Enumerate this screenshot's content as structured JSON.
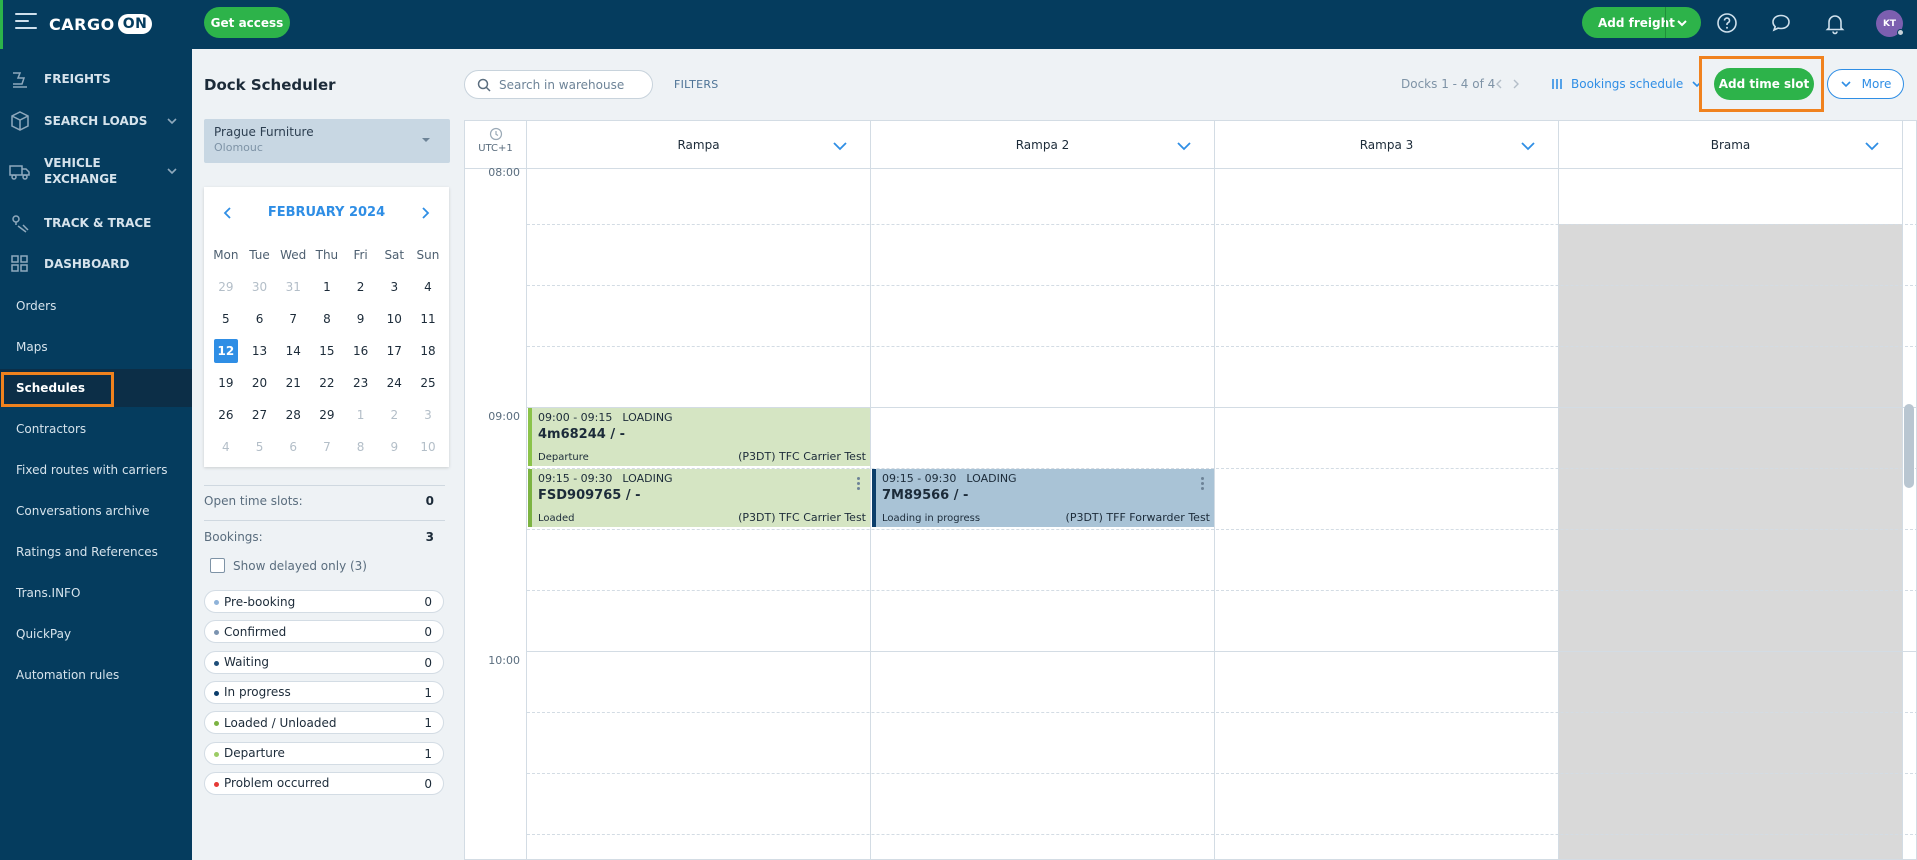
{
  "topbar": {
    "logo_text": "CARGO",
    "logo_on": "ON",
    "get_access": "Get access",
    "add_freight": "Add freight",
    "avatar_initials": "KT"
  },
  "sidebar": {
    "main_items": [
      {
        "label": "FREIGHTS",
        "icon": "freight-icon"
      },
      {
        "label": "SEARCH LOADS",
        "icon": "box-icon"
      },
      {
        "label": "VEHICLE EXCHANGE",
        "icon": "truck-icon"
      },
      {
        "label": "TRACK & TRACE",
        "icon": "track-icon"
      },
      {
        "label": "DASHBOARD",
        "icon": "dashboard-icon"
      }
    ],
    "sub_items": [
      "Orders",
      "Maps",
      "Schedules",
      "Contractors",
      "Fixed routes with carriers",
      "Conversations archive",
      "Ratings and References",
      "Trans.INFO",
      "QuickPay",
      "Automation rules"
    ],
    "active": "Schedules"
  },
  "panel": {
    "title": "Dock Scheduler",
    "warehouse_name": "Prague Furniture",
    "warehouse_city": "Olomouc"
  },
  "calendar": {
    "month": "FEBRUARY 2024",
    "dow": [
      "Mon",
      "Tue",
      "Wed",
      "Thu",
      "Fri",
      "Sat",
      "Sun"
    ],
    "weeks": [
      [
        "29",
        "30",
        "31",
        "1",
        "2",
        "3",
        "4"
      ],
      [
        "5",
        "6",
        "7",
        "8",
        "9",
        "10",
        "11"
      ],
      [
        "12",
        "13",
        "14",
        "15",
        "16",
        "17",
        "18"
      ],
      [
        "19",
        "20",
        "21",
        "22",
        "23",
        "24",
        "25"
      ],
      [
        "26",
        "27",
        "28",
        "29",
        "1",
        "2",
        "3"
      ],
      [
        "4",
        "5",
        "6",
        "7",
        "8",
        "9",
        "10"
      ]
    ],
    "selected": "12"
  },
  "summary": {
    "open_slots_label": "Open time slots:",
    "open_slots_value": "0",
    "bookings_label": "Bookings:",
    "bookings_value": "3",
    "delayed_label": "Show delayed only (3)"
  },
  "statuses": [
    {
      "label": "Pre-booking",
      "count": "0",
      "color": "#8fb3d9"
    },
    {
      "label": "Confirmed",
      "count": "0",
      "color": "#7b93b0"
    },
    {
      "label": "Waiting",
      "count": "0",
      "color": "#1f4e79"
    },
    {
      "label": "In progress",
      "count": "1",
      "color": "#0b3d6b"
    },
    {
      "label": "Loaded / Unloaded",
      "count": "1",
      "color": "#7cb342"
    },
    {
      "label": "Departure",
      "count": "1",
      "color": "#9ccc65"
    },
    {
      "label": "Problem occurred",
      "count": "0",
      "color": "#e53935"
    }
  ],
  "toolbar": {
    "search_placeholder": "Search in warehouse",
    "filters": "FILTERS",
    "docks_count": "Docks 1 - 4 of 4",
    "bookings_schedule": "Bookings schedule",
    "add_time_slot": "Add time slot",
    "more": "More"
  },
  "schedule": {
    "timezone": "UTC+1",
    "docks": [
      "Rampa",
      "Rampa 2",
      "Rampa 3",
      "Brama"
    ],
    "times": [
      "08:00",
      "09:00",
      "10:00"
    ],
    "bookings": [
      {
        "time": "09:00 - 09:15",
        "type": "LOADING",
        "id": "4m68244 / -",
        "status": "Departure",
        "carrier": "(P3DT) TFC Carrier Test",
        "color": "#d5e5c3",
        "border": "#8bc34a"
      },
      {
        "time": "09:15 - 09:30",
        "type": "LOADING",
        "id": "FSD909765 / -",
        "status": "Loaded",
        "carrier": "(P3DT) TFC Carrier Test",
        "color": "#d5e5c3",
        "border": "#7cb342"
      },
      {
        "time": "09:15 - 09:30",
        "type": "LOADING",
        "id": "7M89566 / -",
        "status": "Loading in progress",
        "carrier": "(P3DT) TFF Forwarder Test",
        "color": "#a9c3d6",
        "border": "#0b3d6b"
      }
    ]
  }
}
